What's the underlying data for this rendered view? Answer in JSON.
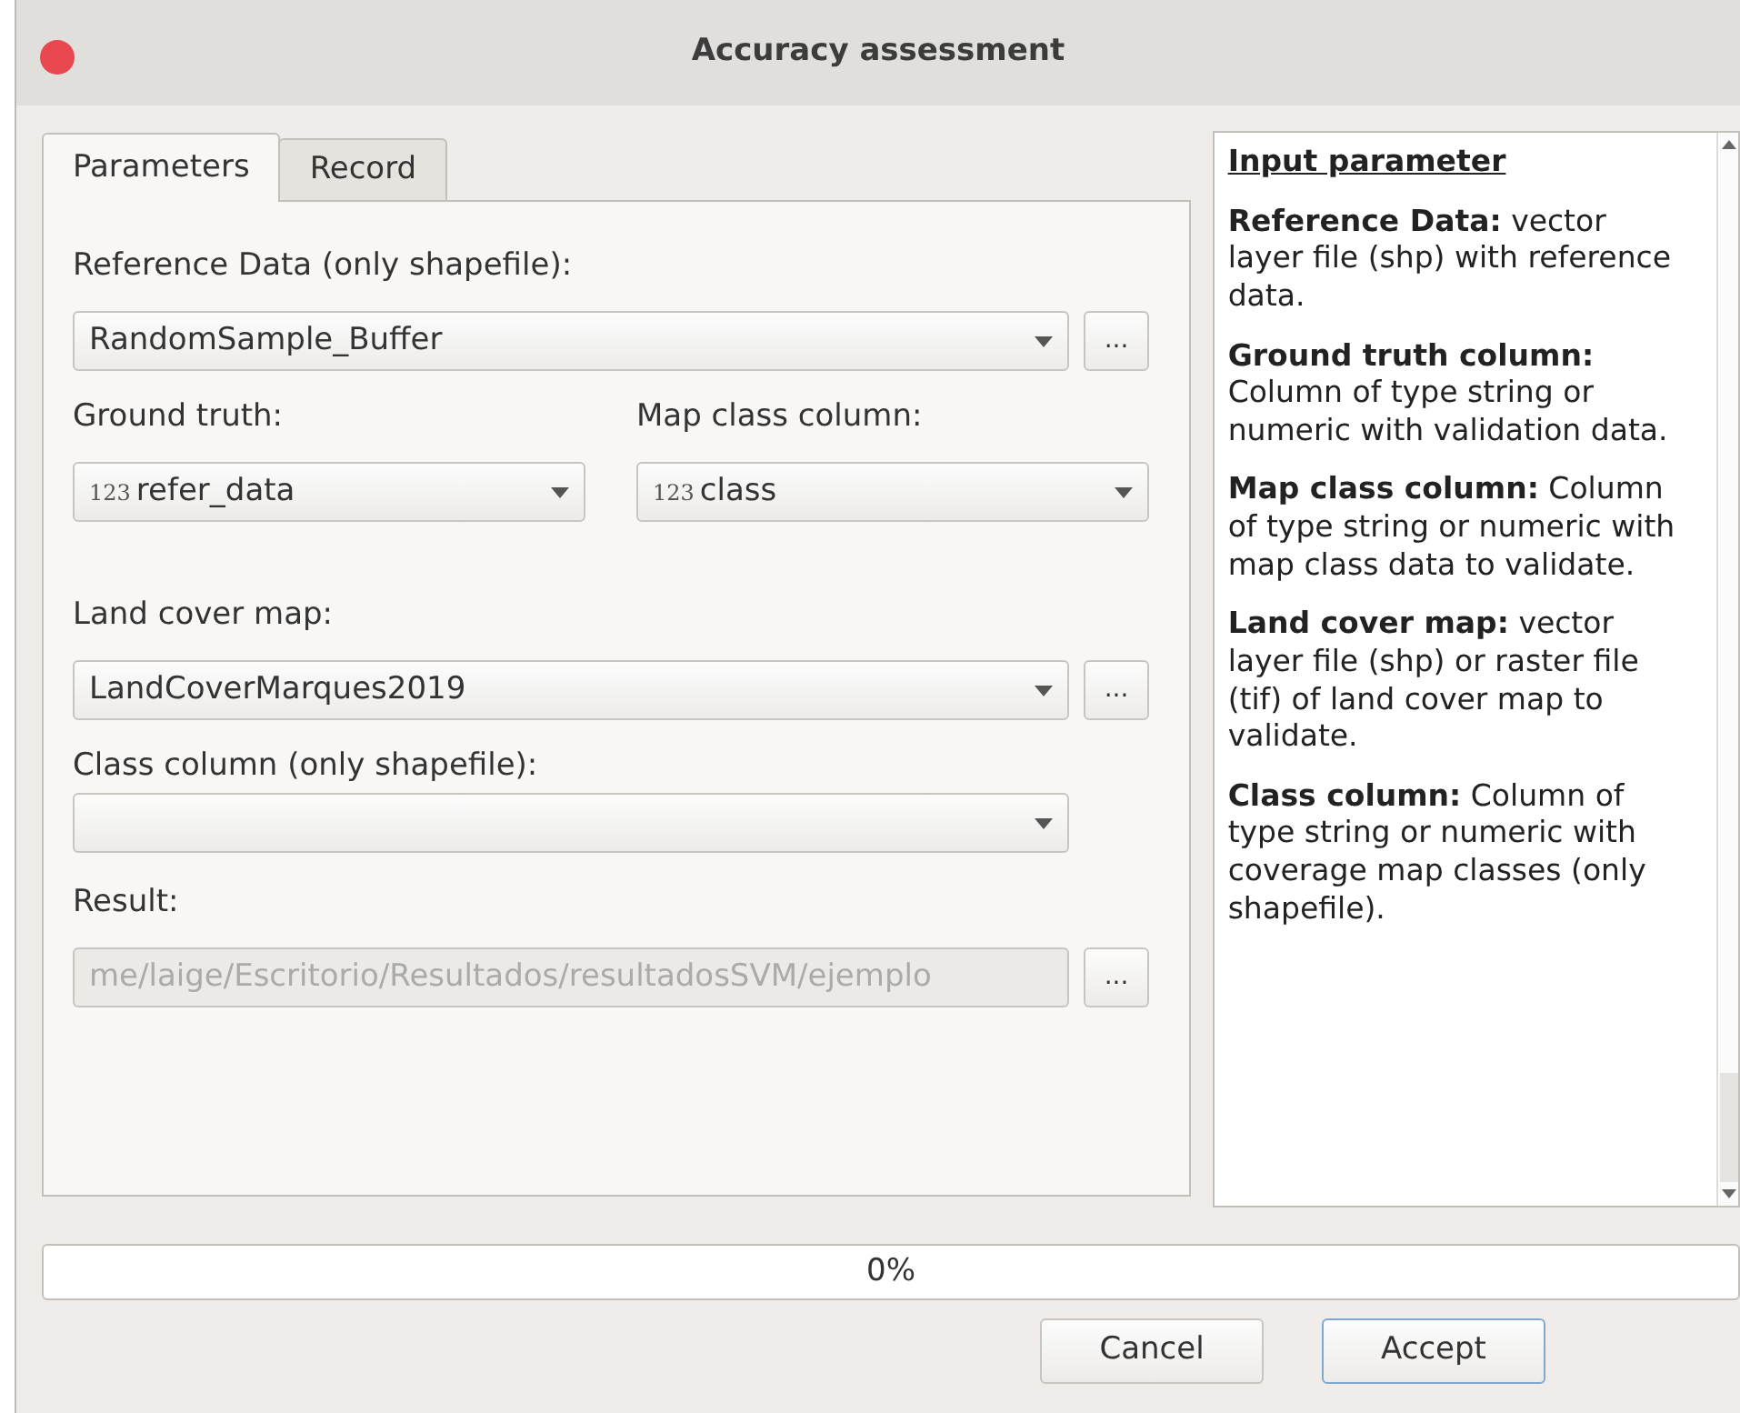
{
  "window": {
    "title": "Accuracy assessment"
  },
  "tabs": [
    {
      "label": "Parameters",
      "selected": true
    },
    {
      "label": "Record",
      "selected": false
    }
  ],
  "form": [
    {
      "kind": "combo",
      "label": "Reference Data (only shapefile):",
      "value": "RandomSample_Buffer",
      "browse": "..."
    },
    {
      "kind": "pair",
      "items": [
        {
          "label": "Ground truth:",
          "type_badge": "123",
          "value": "refer_data"
        },
        {
          "label": "Map class column:",
          "type_badge": "123",
          "value": "class"
        }
      ]
    },
    {
      "kind": "combo",
      "label": "Land cover map:",
      "value": "LandCoverMarques2019",
      "browse": "..."
    },
    {
      "kind": "combo",
      "label": "Class column (only shapefile):"
    },
    {
      "kind": "path",
      "label": "Result:",
      "value": "me/laige/Escritorio/Resultados/resultadosSVM/ejemplo",
      "disabled": true,
      "browse": "..."
    }
  ],
  "help": {
    "heading": "Input parameter",
    "paragraphs": [
      "**Reference Data:** vector layer file (shp) with reference data.",
      "**Ground truth column:** Column of type string or numeric with validation data.",
      "**Map class column:** Column of type string or numeric with map class data to validate.",
      "**Land cover map:** vector layer file (shp) or raster file (tif) of land cover map to validate.",
      "**Class column:** Column of type string or numeric with coverage map classes (only shapefile)."
    ]
  },
  "progress": {
    "level": 0,
    "text": "0%"
  },
  "buttons": [
    {
      "label": "Cancel",
      "default": false
    },
    {
      "label": "Accept",
      "default": true
    }
  ]
}
